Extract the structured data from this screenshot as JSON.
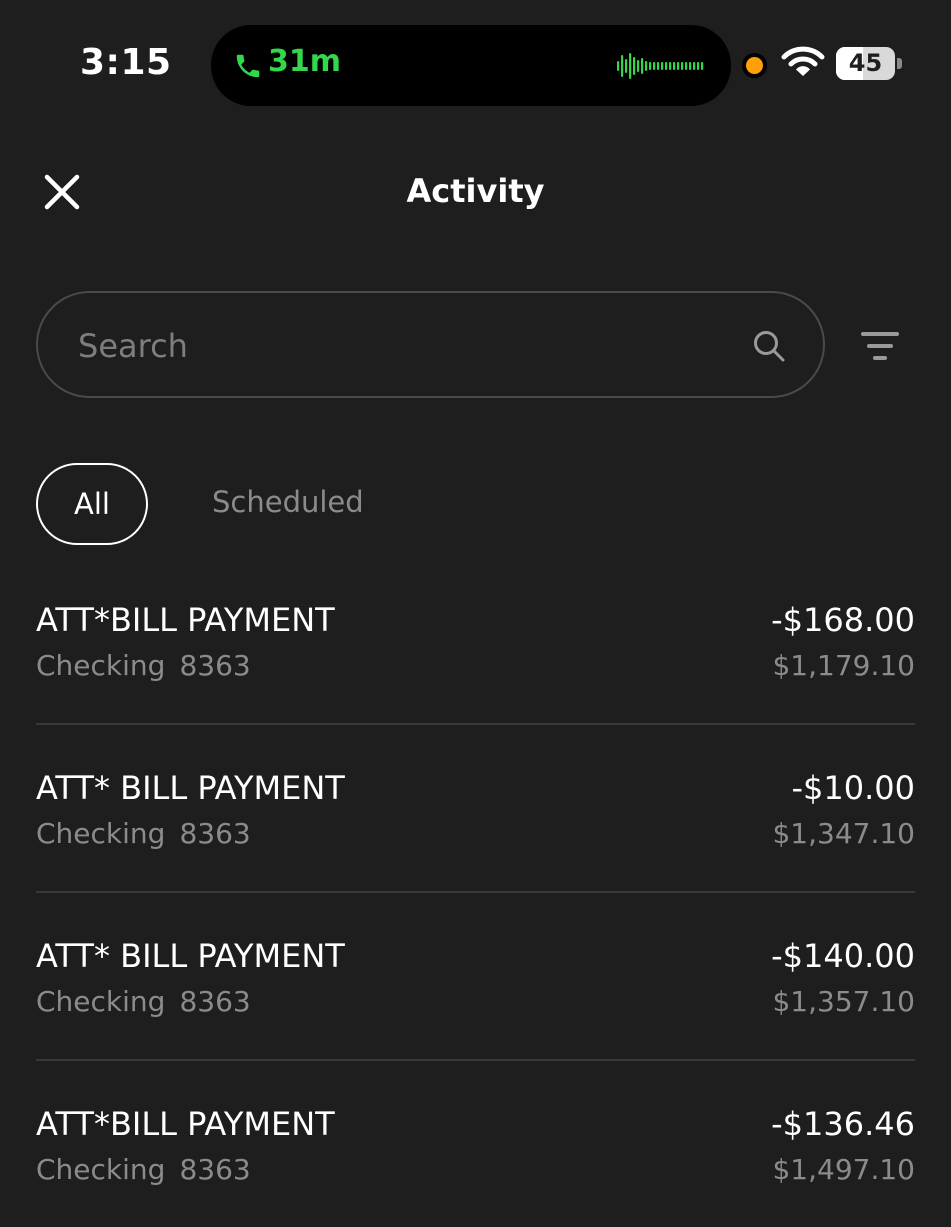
{
  "status_bar": {
    "time": "3:15",
    "call_duration": "31m",
    "battery_level": "45",
    "battery_fraction": 0.45,
    "call_color": "#32d74b",
    "privacy_indicator_color": "#ff9f0a",
    "icons": [
      "phone-icon",
      "waveform-icon",
      "wifi-icon",
      "battery-icon"
    ]
  },
  "header": {
    "title": "Activity",
    "close_icon": "close-icon"
  },
  "search": {
    "placeholder": "Search",
    "value": "",
    "icon": "search-icon",
    "filter_icon": "filter-icon"
  },
  "tabs": [
    {
      "label": "All",
      "selected": true
    },
    {
      "label": "Scheduled",
      "selected": false
    }
  ],
  "transactions": [
    {
      "description": "ATT*BILL PAYMENT",
      "account": "Checking",
      "account_number": "8363",
      "amount": "-$168.00",
      "balance": "$1,179.10"
    },
    {
      "description": "ATT* BILL PAYMENT",
      "account": "Checking",
      "account_number": "8363",
      "amount": "-$10.00",
      "balance": "$1,347.10"
    },
    {
      "description": "ATT* BILL PAYMENT",
      "account": "Checking",
      "account_number": "8363",
      "amount": "-$140.00",
      "balance": "$1,357.10"
    },
    {
      "description": "ATT*BILL PAYMENT",
      "account": "Checking",
      "account_number": "8363",
      "amount": "-$136.46",
      "balance": "$1,497.10"
    }
  ]
}
